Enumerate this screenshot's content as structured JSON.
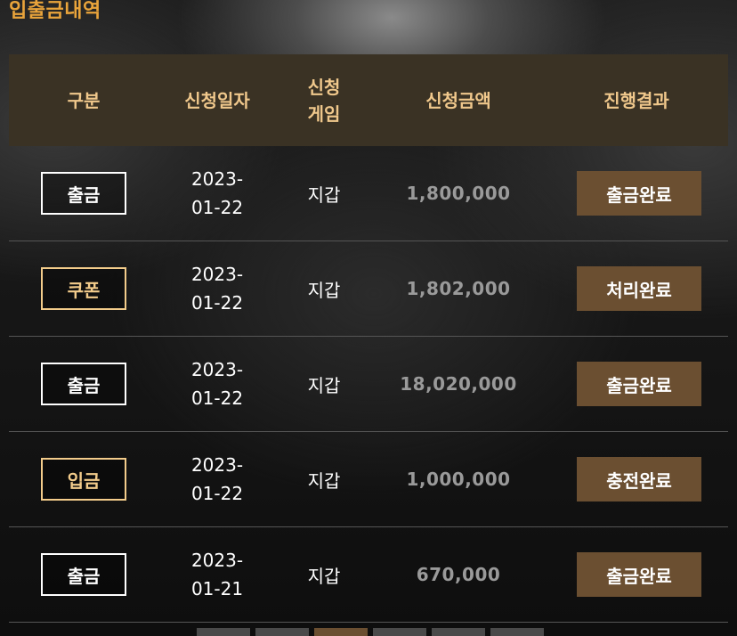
{
  "page": {
    "title": "입출금내역"
  },
  "table": {
    "headers": {
      "type": "구분",
      "date": "신청일자",
      "game": "신청게임",
      "amount": "신청금액",
      "result": "진행결과"
    },
    "rows": [
      {
        "type": "출금",
        "type_color": "white",
        "date": "2023-01-22",
        "game": "지갑",
        "amount": "1,800,000",
        "result": "출금완료"
      },
      {
        "type": "쿠폰",
        "type_color": "gold",
        "date": "2023-01-22",
        "game": "지갑",
        "amount": "1,802,000",
        "result": "처리완료"
      },
      {
        "type": "출금",
        "type_color": "white",
        "date": "2023-01-22",
        "game": "지갑",
        "amount": "18,020,000",
        "result": "출금완료"
      },
      {
        "type": "입금",
        "type_color": "gold",
        "date": "2023-01-22",
        "game": "지갑",
        "amount": "1,000,000",
        "result": "충전완료"
      },
      {
        "type": "출금",
        "type_color": "white",
        "date": "2023-01-21",
        "game": "지갑",
        "amount": "670,000",
        "result": "출금완료"
      }
    ]
  },
  "colors": {
    "title": "#e9a43b",
    "header_bg": "#3a3224",
    "header_text": "#f0c88c",
    "status_button": "#6b4f31",
    "amount_text": "#9a9a9a"
  }
}
